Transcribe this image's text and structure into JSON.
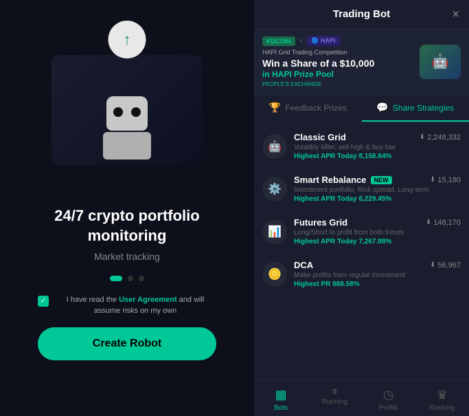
{
  "left": {
    "heading": "24/7 crypto portfolio monitoring",
    "subheading": "Market tracking",
    "agreement_text": "I have read the ",
    "agreement_link": "User Agreement",
    "agreement_suffix": " and will assume risks on my own",
    "create_btn": "Create Robot",
    "dots": [
      "active",
      "inactive",
      "inactive"
    ]
  },
  "right": {
    "modal_title": "Trading Bot",
    "close_label": "×",
    "banner": {
      "kucoin_label": "KUCOIN",
      "cross": "×",
      "hapi_label": "🔵 HAPI",
      "competition_text": "HAPI Grid Trading Competition",
      "main_text": "Win a Share of a $10,000",
      "subtitle": "in HAPI Prize Pool",
      "exchange_label": "PEOPLE'S EXCHANGE"
    },
    "tabs": [
      {
        "id": "feedback",
        "label": "Feedback Prizes",
        "active": false
      },
      {
        "id": "share",
        "label": "Share Strategies",
        "active": true
      }
    ],
    "strategies": [
      {
        "id": "classic-grid",
        "name": "Classic Grid",
        "is_new": false,
        "count": "2,248,332",
        "desc": "Volatility killer, sell high & buy low",
        "apr_label": "Highest APR Today",
        "apr_value": "8,158.84%",
        "icon": "🤖"
      },
      {
        "id": "smart-rebalance",
        "name": "Smart Rebalance",
        "is_new": true,
        "count": "15,180",
        "desc": "Investment portfolio, Risk spread, Long-term",
        "apr_label": "Highest APR Today",
        "apr_value": "6,229.45%",
        "icon": "⚙️"
      },
      {
        "id": "futures-grid",
        "name": "Futures Grid",
        "is_new": false,
        "count": "148,170",
        "desc": "Long/Short to profit from both trends",
        "apr_label": "Highest APR Today",
        "apr_value": "7,267.88%",
        "icon": "📈"
      },
      {
        "id": "dca",
        "name": "DCA",
        "is_new": false,
        "count": "56,967",
        "desc": "Make profits from regular investment",
        "apr_label": "Highest PR",
        "apr_value": "888.58%",
        "icon": "🪙"
      }
    ],
    "bottom_nav": [
      {
        "id": "bots",
        "label": "Bots",
        "icon": "▦",
        "active": true,
        "badge": null
      },
      {
        "id": "running",
        "label": "Running",
        "icon": "▷",
        "active": false,
        "badge": "0"
      },
      {
        "id": "profits",
        "label": "Profits",
        "icon": "◷",
        "active": false,
        "badge": null
      },
      {
        "id": "ranking",
        "label": "Ranking",
        "icon": "♛",
        "active": false,
        "badge": null
      }
    ]
  }
}
